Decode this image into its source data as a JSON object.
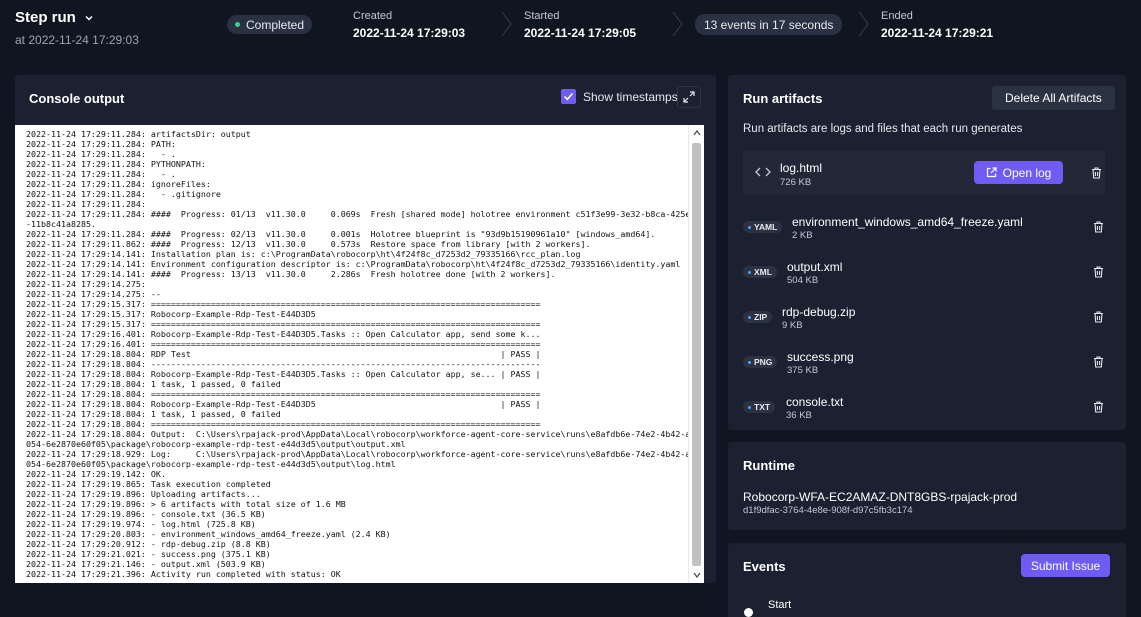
{
  "header": {
    "title": "Step run",
    "subtitle": "at 2022-11-24 17:29:03",
    "status": "Completed",
    "created_label": "Created",
    "created_value": "2022-11-24 17:29:03",
    "started_label": "Started",
    "started_value": "2022-11-24 17:29:05",
    "events_summary": "13 events in 17 seconds",
    "ended_label": "Ended",
    "ended_value": "2022-11-24 17:29:21"
  },
  "console": {
    "title": "Console output",
    "show_timestamps_label": "Show timestamps",
    "show_timestamps_checked": true,
    "lines": [
      "2022-11-24 17:29:11.284: artifactsDir: output",
      "2022-11-24 17:29:11.284: PATH:",
      "2022-11-24 17:29:11.284:   - .",
      "2022-11-24 17:29:11.284: PYTHONPATH:",
      "2022-11-24 17:29:11.284:   - .",
      "2022-11-24 17:29:11.284: ignoreFiles:",
      "2022-11-24 17:29:11.284:   - .gitignore",
      "2022-11-24 17:29:11.284:",
      "2022-11-24 17:29:11.284: ####  Progress: 01/13  v11.30.0     0.069s  Fresh [shared mode] holotree environment c51f3e99-3e32-b8ca-425e",
      "-11b8c41a8285.",
      "2022-11-24 17:29:11.284: ####  Progress: 02/13  v11.30.0     0.001s  Holotree blueprint is \"93d9b15190961a10\" [windows_amd64].",
      "2022-11-24 17:29:11.862: ####  Progress: 12/13  v11.30.0     0.573s  Restore space from library [with 2 workers].",
      "2022-11-24 17:29:14.141: Installation plan is: c:\\ProgramData\\robocorp\\ht\\4f24f8c_d7253d2_79335166\\rcc_plan.log",
      "2022-11-24 17:29:14.141: Environment configuration descriptor is: c:\\ProgramData\\robocorp\\ht\\4f24f8c_d7253d2_79335166\\identity.yaml",
      "2022-11-24 17:29:14.141: ####  Progress: 13/13  v11.30.0     2.286s  Fresh holotree done [with 2 workers].",
      "2022-11-24 17:29:14.275:",
      "2022-11-24 17:29:14.275: --",
      "2022-11-24 17:29:15.317: ==============================================================================",
      "2022-11-24 17:29:15.317: Robocorp-Example-Rdp-Test-E44D3D5",
      "2022-11-24 17:29:15.317: ==============================================================================",
      "2022-11-24 17:29:16.401: Robocorp-Example-Rdp-Test-E44D3D5.Tasks :: Open Calculator app, send some k...",
      "2022-11-24 17:29:16.401: ==============================================================================",
      "2022-11-24 17:29:18.804: RDP Test                                                              | PASS |",
      "2022-11-24 17:29:18.804: ------------------------------------------------------------------------------",
      "2022-11-24 17:29:18.804: Robocorp-Example-Rdp-Test-E44D3D5.Tasks :: Open Calculator app, se... | PASS |",
      "2022-11-24 17:29:18.804: 1 task, 1 passed, 0 failed",
      "2022-11-24 17:29:18.804: ==============================================================================",
      "2022-11-24 17:29:18.804: Robocorp-Example-Rdp-Test-E44D3D5                                     | PASS |",
      "2022-11-24 17:29:18.804: 1 task, 1 passed, 0 failed",
      "2022-11-24 17:29:18.804: ==============================================================================",
      "2022-11-24 17:29:18.804: Output:  C:\\Users\\rpajack-prod\\AppData\\Local\\robocorp\\workforce-agent-core-service\\runs\\e8afdb6e-74e2-4b42-a",
      "054-6e2870e60f05\\package\\robocorp-example-rdp-test-e44d3d5\\output\\output.xml",
      "2022-11-24 17:29:18.929: Log:     C:\\Users\\rpajack-prod\\AppData\\Local\\robocorp\\workforce-agent-core-service\\runs\\e8afdb6e-74e2-4b42-a",
      "054-6e2870e60f05\\package\\robocorp-example-rdp-test-e44d3d5\\output\\log.html",
      "2022-11-24 17:29:19.142: OK.",
      "2022-11-24 17:29:19.865: Task execution completed",
      "2022-11-24 17:29:19.896: Uploading artifacts...",
      "2022-11-24 17:29:19.896: > 6 artifacts with total size of 1.6 MB",
      "2022-11-24 17:29:19.896: - console.txt (36.5 KB)",
      "2022-11-24 17:29:19.974: - log.html (725.8 KB)",
      "2022-11-24 17:29:20.803: - environment_windows_amd64_freeze.yaml (2.4 KB)",
      "2022-11-24 17:29:20.912: - rdp-debug.zip (8.8 KB)",
      "2022-11-24 17:29:21.021: - success.png (375.1 KB)",
      "2022-11-24 17:29:21.146: - output.xml (503.9 KB)",
      "2022-11-24 17:29:21.396: Activity run completed with status: OK"
    ]
  },
  "artifacts": {
    "title": "Run artifacts",
    "delete_all_label": "Delete All Artifacts",
    "description": "Run artifacts are logs and files that each run generates",
    "log": {
      "name": "log.html",
      "size": "726 KB",
      "open_label": "Open log"
    },
    "items": [
      {
        "type": "YAML",
        "name": "environment_windows_amd64_freeze.yaml",
        "size": "2 KB"
      },
      {
        "type": "XML",
        "name": "output.xml",
        "size": "504 KB"
      },
      {
        "type": "ZIP",
        "name": "rdp-debug.zip",
        "size": "9 KB"
      },
      {
        "type": "PNG",
        "name": "success.png",
        "size": "375 KB"
      },
      {
        "type": "TXT",
        "name": "console.txt",
        "size": "36 KB"
      }
    ]
  },
  "runtime": {
    "title": "Runtime",
    "name": "Robocorp-WFA-EC2AMAZ-DNT8GBS-rpajack-prod",
    "id": "d1f9dfac-3764-4e8e-908f-d97c5fb3c174"
  },
  "events": {
    "title": "Events",
    "submit_label": "Submit Issue",
    "first_event": "Start"
  },
  "colors": {
    "background": "#101522",
    "panel": "#1b2130",
    "accent": "#6d5cf6",
    "status_green": "#3ecf8e"
  }
}
